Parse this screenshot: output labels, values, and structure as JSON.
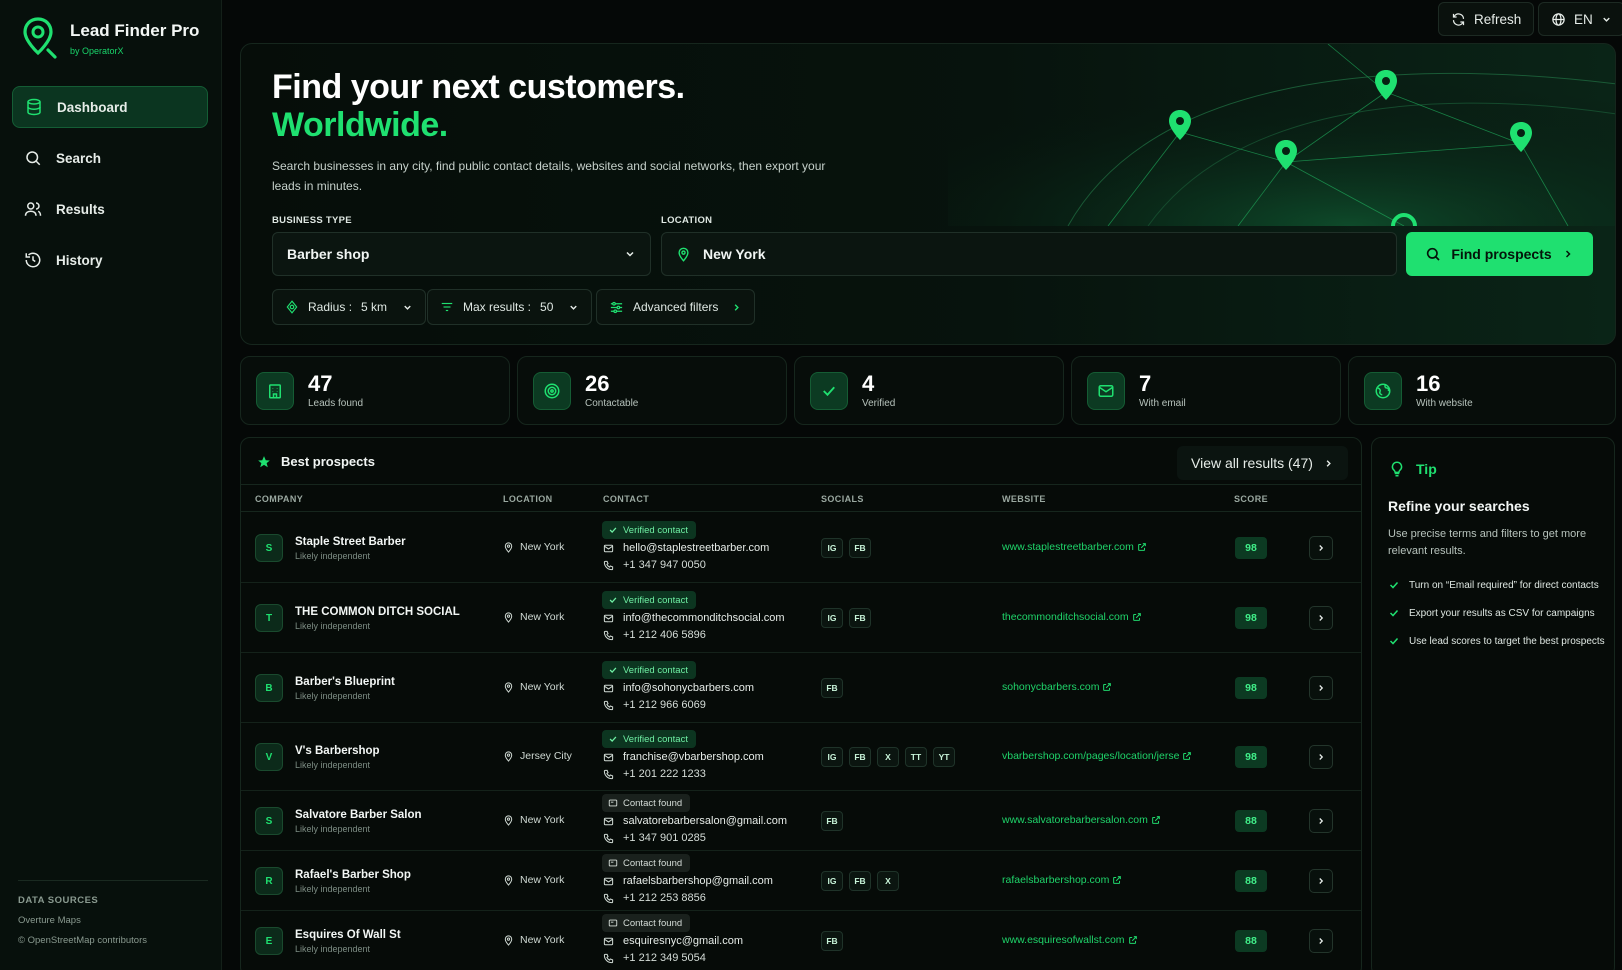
{
  "app": {
    "title": "Lead Finder Pro",
    "subtitle": "by OperatorX"
  },
  "colors": {
    "accent": "#1fe070",
    "background": "#050807",
    "panel": "#07100c"
  },
  "sidebar": {
    "items": [
      {
        "label": "Dashboard",
        "icon": "database-icon",
        "active": true
      },
      {
        "label": "Search",
        "icon": "search-icon"
      },
      {
        "label": "Results",
        "icon": "users-icon"
      },
      {
        "label": "History",
        "icon": "history-icon"
      }
    ],
    "sources_title": "DATA SOURCES",
    "sources": [
      "Overture Maps",
      "© OpenStreetMap contributors"
    ]
  },
  "topbar": {
    "refresh_label": "Refresh",
    "language": "EN"
  },
  "hero": {
    "title_line1": "Find your next customers.",
    "title_line2": "Worldwide.",
    "description": "Search businesses in any city, find public contact details, websites and social networks, then export your leads in minutes.",
    "business_type_label": "BUSINESS TYPE",
    "business_type_value": "Barber shop",
    "location_label": "LOCATION",
    "location_value": "New York",
    "cta_label": "Find prospects",
    "radius_label": "Radius :",
    "radius_value": "5 km",
    "max_results_label": "Max results :",
    "max_results_value": "50",
    "advanced_label": "Advanced filters"
  },
  "stats": [
    {
      "value": "47",
      "label": "Leads found",
      "icon": "building-icon"
    },
    {
      "value": "26",
      "label": "Contactable",
      "icon": "target-icon"
    },
    {
      "value": "4",
      "label": "Verified",
      "icon": "check-icon"
    },
    {
      "value": "7",
      "label": "With email",
      "icon": "mail-icon"
    },
    {
      "value": "16",
      "label": "With website",
      "icon": "globe-icon"
    }
  ],
  "prospects": {
    "title": "Best prospects",
    "view_all_label": "View all results (47)",
    "columns": [
      "COMPANY",
      "LOCATION",
      "CONTACT",
      "SOCIALS",
      "WEBSITE",
      "SCORE"
    ],
    "rows": [
      {
        "initial": "S",
        "name": "Staple Street Barber",
        "sub": "Likely independent",
        "location": "New York",
        "badge": "Verified contact",
        "badge_type": "verified",
        "email": "hello@staplestreetbarber.com",
        "phone": "+1 347 947 0050",
        "socials": [
          "IG",
          "FB"
        ],
        "website": "www.staplestreetbarber.com",
        "score": "98"
      },
      {
        "initial": "T",
        "name": "THE COMMON DITCH SOCIAL",
        "sub": "Likely independent",
        "location": "New York",
        "badge": "Verified contact",
        "badge_type": "verified",
        "email": "info@thecommonditchsocial.com",
        "phone": "+1 212 406 5896",
        "socials": [
          "IG",
          "FB"
        ],
        "website": "thecommonditchsocial.com",
        "score": "98"
      },
      {
        "initial": "B",
        "name": "Barber's Blueprint",
        "sub": "Likely independent",
        "location": "New York",
        "badge": "Verified contact",
        "badge_type": "verified",
        "email": "info@sohonycbarbers.com",
        "phone": "+1 212 966 6069",
        "socials": [
          "FB"
        ],
        "website": "sohonycbarbers.com",
        "score": "98"
      },
      {
        "initial": "V",
        "name": "V's Barbershop",
        "sub": "Likely independent",
        "location": "Jersey City",
        "badge": "Verified contact",
        "badge_type": "verified",
        "email": "franchise@vbarbershop.com",
        "phone": "+1 201 222 1233",
        "socials": [
          "IG",
          "FB",
          "X",
          "TT",
          "YT"
        ],
        "website": "vbarbershop.com/pages/location/jerse",
        "score": "98"
      },
      {
        "initial": "S",
        "name": "Salvatore Barber Salon",
        "sub": "Likely independent",
        "location": "New York",
        "badge": "Contact found",
        "badge_type": "found",
        "email": "salvatorebarbersalon@gmail.com",
        "phone": "+1 347 901 0285",
        "socials": [
          "FB"
        ],
        "website": "www.salvatorebarbersalon.com",
        "score": "88"
      },
      {
        "initial": "R",
        "name": "Rafael's Barber Shop",
        "sub": "Likely independent",
        "location": "New York",
        "badge": "Contact found",
        "badge_type": "found",
        "email": "rafaelsbarbershop@gmail.com",
        "phone": "+1 212 253 8856",
        "socials": [
          "IG",
          "FB",
          "X"
        ],
        "website": "rafaelsbarbershop.com",
        "score": "88"
      },
      {
        "initial": "E",
        "name": "Esquires Of Wall St",
        "sub": "Likely independent",
        "location": "New York",
        "badge": "Contact found",
        "badge_type": "found",
        "email": "esquiresnyc@gmail.com",
        "phone": "+1 212 349 5054",
        "socials": [
          "FB"
        ],
        "website": "www.esquiresofwallst.com",
        "score": "88"
      }
    ]
  },
  "tip": {
    "label": "Tip",
    "title": "Refine your searches",
    "description": "Use precise terms and filters to get more relevant results.",
    "items": [
      "Turn on “Email required” for direct contacts",
      "Export your results as CSV for campaigns",
      "Use lead scores to target the best prospects"
    ]
  }
}
